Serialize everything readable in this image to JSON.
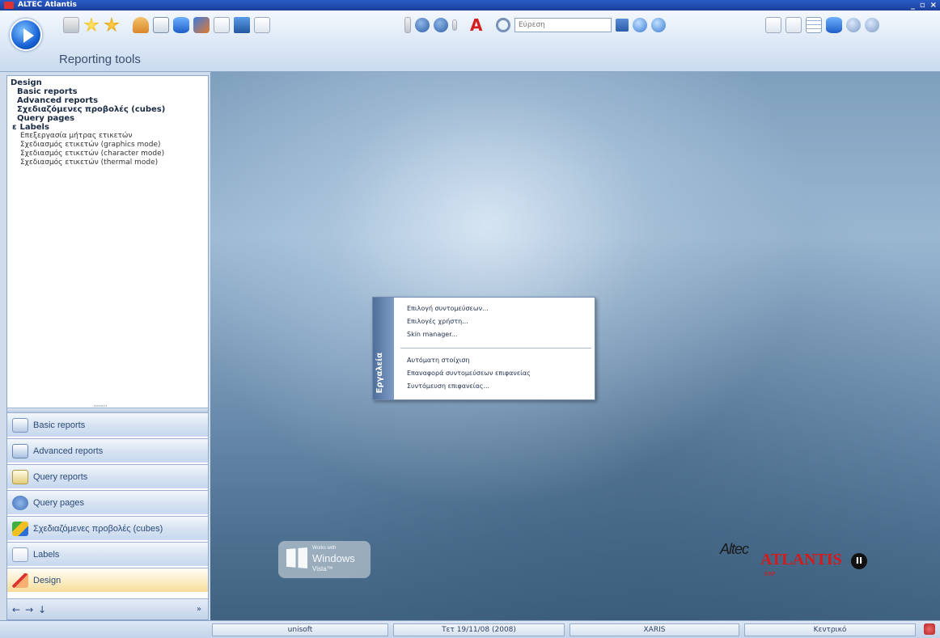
{
  "window": {
    "title": "ALTEC Atlantis",
    "controls": [
      "_",
      "▫",
      "×"
    ]
  },
  "ribbon": {
    "title": "Reporting tools",
    "search_placeholder": "Εύρεση"
  },
  "tree": {
    "root": "Design",
    "items": [
      "Basic reports",
      "Advanced reports",
      "Σχεδιαζόμενες προβολές (cubes)",
      "Query pages"
    ],
    "group": {
      "toggle": "ɛ",
      "label": "Labels"
    },
    "subitems": [
      "Επεξεργασία μήτρας ετικετών",
      "Σχεδιασμός ετικετών (graphics mode)",
      "Σχεδιασμός ετικετών (character mode)",
      "Σχεδιασμός ετικετών (thermal mode)"
    ]
  },
  "nav_buttons": [
    "Basic reports",
    "Advanced reports",
    "Query reports",
    "Query pages",
    "Σχεδιαζόμενες προβολές (cubes)",
    "Labels",
    "Design"
  ],
  "nav_footer": {
    "back": "←",
    "forward": "→",
    "down": "↓",
    "more": "»"
  },
  "context_menu": {
    "title": "Εργαλεία",
    "items_a": [
      "Επιλογή συντομεύσεων...",
      "Επιλογές χρήστη...",
      "Skin manager..."
    ],
    "items_b": [
      "Αυτόματη στοίχιση",
      "Επαναφορά συντομεύσεων επιφανείας",
      "Συντόμευση επιφανείας..."
    ]
  },
  "vista_logo": {
    "line1": "Works with",
    "line2": "Windows",
    "line3": "Vista™"
  },
  "brand": {
    "altec": "Altec",
    "atlantis": "ATLANTIS",
    "badge": "II",
    "sub": "ERP"
  },
  "status": {
    "user": "unisoft",
    "date": "Τετ 19/11/08 (2008)",
    "account": "XARIS",
    "branch": "Κεντρικό"
  }
}
